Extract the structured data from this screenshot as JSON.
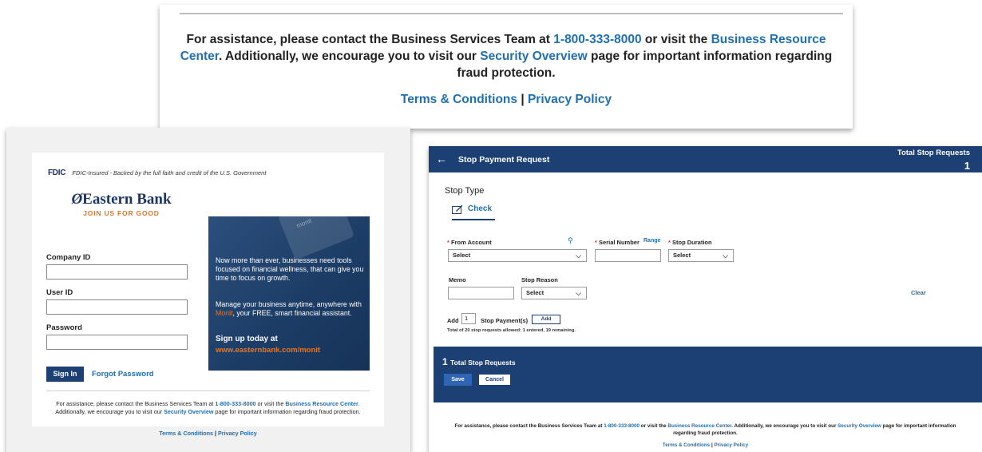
{
  "footer": {
    "assist_pre": "For assistance, please contact the Business Services Team at ",
    "phone": "1-800-333-8000",
    "assist_mid": " or visit the ",
    "resource_link": "Business Resource Center",
    "assist_mid2": ". Additionally, we encourage you to visit our ",
    "security_link": "Security Overview",
    "assist_post": " page for important information regarding fraud protection.",
    "terms_link": "Terms & Conditions",
    "separator": "|",
    "privacy_link": "Privacy Policy"
  },
  "login": {
    "fdic_logo": "FDIC",
    "fdic_text": "FDIC-Insured - Backed by the full faith and credit of the U.S. Government",
    "bank_name": "Eastern Bank",
    "bank_slogan": "JOIN US FOR GOOD",
    "company_id_label": "Company ID",
    "user_id_label": "User ID",
    "password_label": "Password",
    "sign_in_label": "Sign In",
    "forgot_password_label": "Forgot Password",
    "promo": {
      "phone_text": "monit",
      "p1": "Now more than ever, businesses need tools focused on financial wellness, that can give you time to focus on growth.",
      "p2_pre": "Manage your business anytime, anywhere with ",
      "p2_highlight": "Monit",
      "p2_post": ", your FREE, smart financial assistant.",
      "p3": "Sign up today at",
      "p4": "www.easternbank.com/monit"
    }
  },
  "stop_payment": {
    "back_icon": "arrow-left-icon",
    "title": "Stop Payment Request",
    "total_label": "Total Stop Requests",
    "total_value": "1",
    "stop_type_label": "Stop Type",
    "check_tab_label": "Check",
    "required_mark": "*",
    "from_account_label": "From Account",
    "from_account_value": "Select",
    "serial_number_label": "Serial Number",
    "range_link": "Range",
    "stop_duration_label": "Stop Duration",
    "stop_duration_value": "Select",
    "memo_label": "Memo",
    "stop_reason_label": "Stop Reason",
    "stop_reason_value": "Select",
    "clear_link": "Clear",
    "add_label": "Add",
    "add_count": "1",
    "add_suffix": "Stop Payment(s)",
    "add_button": "Add",
    "allowed_text": "Total of 20 stop requests allowed: 1 entered, 19 remaining.",
    "band_count": "1",
    "band_label": "Total Stop Requests",
    "save_label": "Save",
    "cancel_label": "Cancel"
  },
  "colors": {
    "navy": "#1c3f74",
    "link": "#1f6fb2",
    "orange": "#e57522",
    "required": "#d9342b"
  }
}
